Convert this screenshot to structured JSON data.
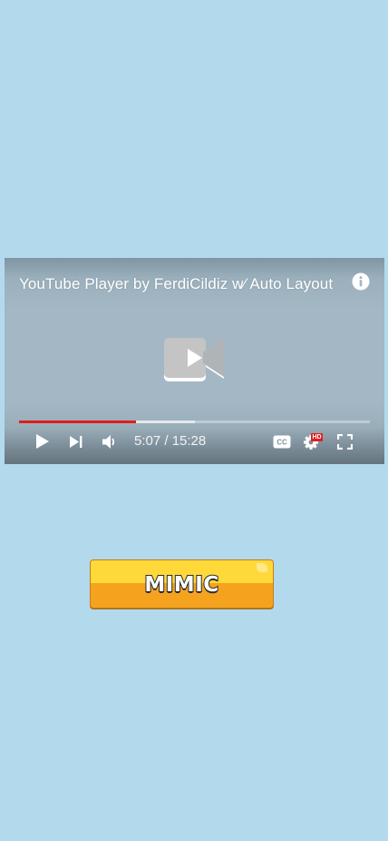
{
  "player": {
    "title": "YouTube Player by FerdiCildiz w⁄ Auto Layout",
    "time_display": "5:07 / 15:28",
    "progress": {
      "played_fraction": 0.333,
      "buffered_fraction": 0.5
    },
    "colors": {
      "progress_played": "#e21d1d",
      "icon": "#ffffff",
      "hd_badge": "#e21d1d"
    },
    "controls": {
      "play_icon": "play-icon",
      "next_icon": "skip-next-icon",
      "volume_icon": "volume-icon",
      "captions_icon": "closed-captions-icon",
      "settings_icon": "settings-gear-icon",
      "hd_badge_label": "HD",
      "fullscreen_icon": "fullscreen-icon",
      "info_icon": "info-icon",
      "logo_icon": "video-camera-play-icon"
    }
  },
  "mimic_button": {
    "label": "MIMIC",
    "colors": {
      "top": "#ffd93a",
      "bottom": "#f5a31f",
      "text_outline": "#2a2a2a"
    }
  }
}
